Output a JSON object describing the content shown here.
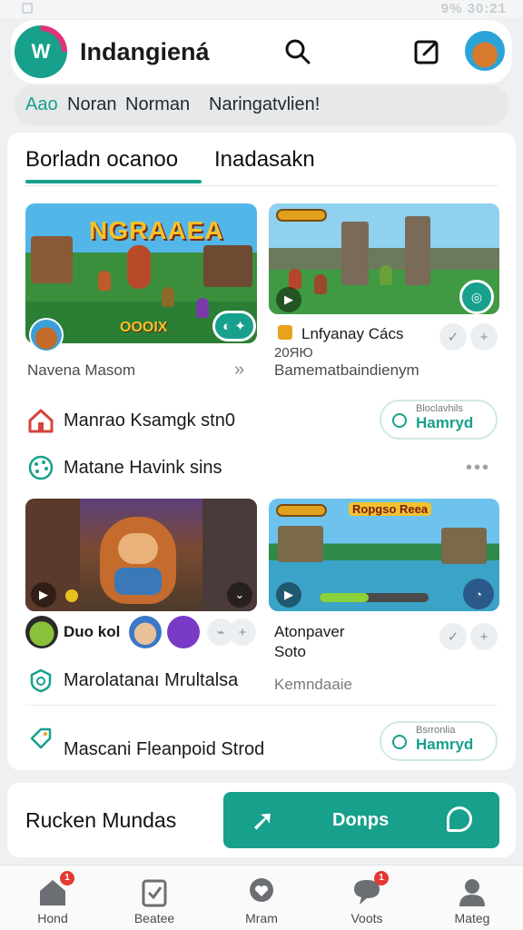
{
  "status_bar": {
    "right_text": "9% 30:21"
  },
  "app": {
    "title": "Indangiená",
    "logo_text": "W"
  },
  "chips": [
    "Aao",
    "Noran",
    "Norman",
    "Naringatvlien!"
  ],
  "tabs": [
    "Borladn ocanoo",
    "Inadasakn"
  ],
  "featured": [
    {
      "game_title": "NGRAAEA",
      "game_sub": "OOOIX",
      "meta": "Navena Masom",
      "more": "»"
    },
    {
      "title": "Lnfyanay Cács",
      "sub": "20ЯЮ",
      "meta": "Bamematbaindienym"
    }
  ],
  "rows": [
    {
      "label": "Manrao Ksamgk stn0",
      "button_top": "Bloclavhils",
      "button_main": "Hamryd"
    },
    {
      "label": "Matane Havink sins"
    }
  ],
  "second": [
    {
      "names": "Duo kol"
    },
    {
      "title": "Atonpaver",
      "sub": "Soto",
      "meta": "Kemndaaie",
      "hud_title": "Ropgso Reea"
    }
  ],
  "rows2": [
    {
      "label": "Marolatanaı Mrultalsa"
    },
    {
      "label": "Mascani Fleanpoid Strod",
      "button_top": "Bsrronlia",
      "button_main": "Hamryd"
    }
  ],
  "bottom_card": {
    "label": "Rucken Mundas",
    "cta_label": "Donps"
  },
  "nav": [
    {
      "label": "Hond",
      "badge": "1"
    },
    {
      "label": "Beatee"
    },
    {
      "label": "Mram"
    },
    {
      "label": "Voots",
      "badge": "1"
    },
    {
      "label": "Mateg"
    }
  ],
  "colors": {
    "accent": "#17a08c",
    "badge": "#e53935",
    "logo_ring": "#e4327a"
  }
}
